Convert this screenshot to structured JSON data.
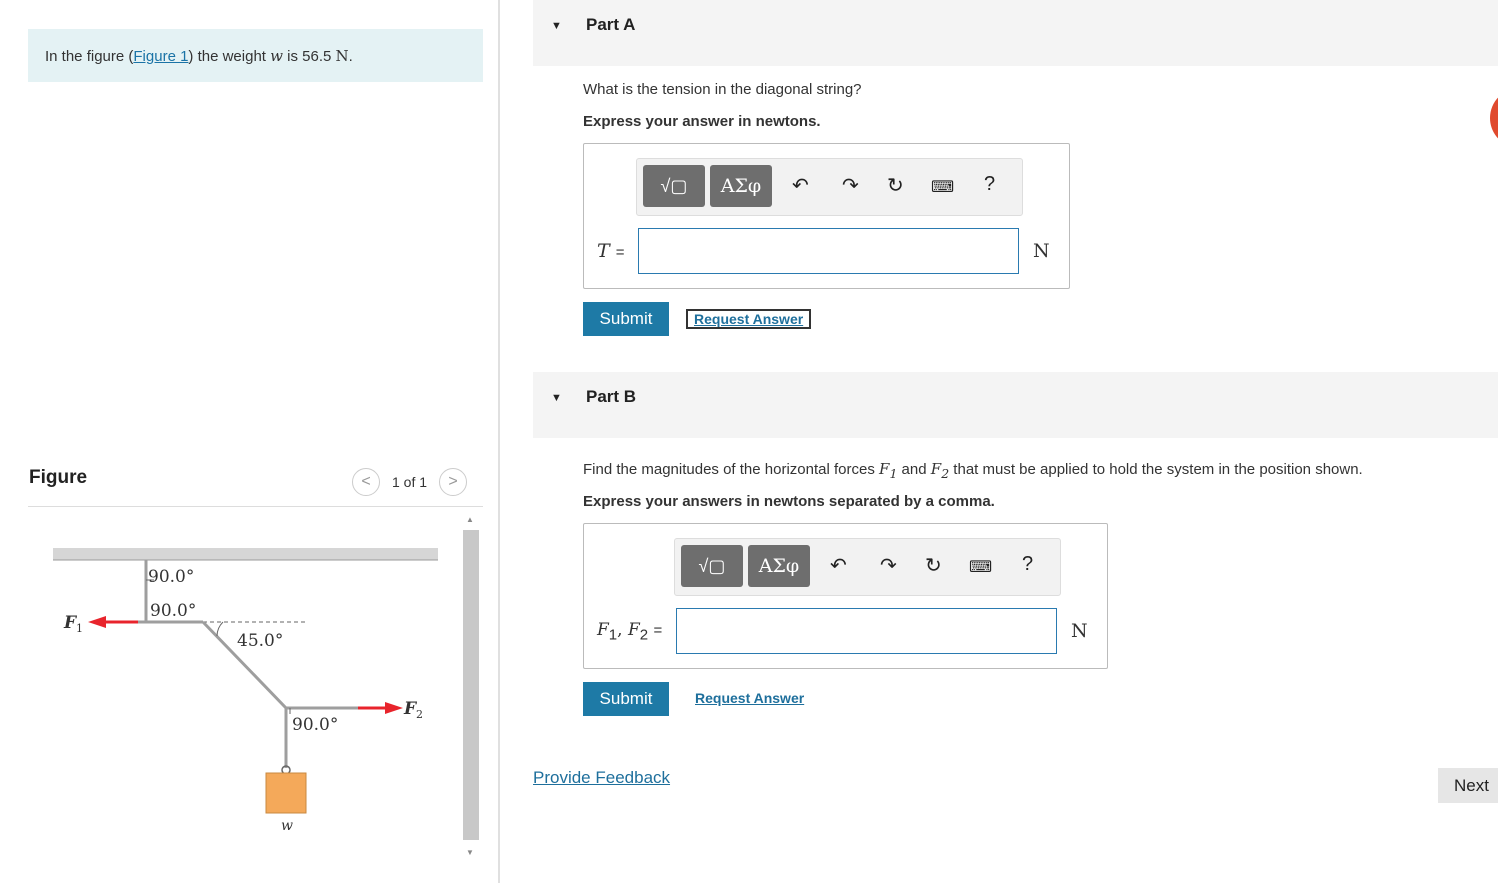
{
  "problem": {
    "prefix": "In the figure (",
    "link": "Figure 1",
    "middle": ") the weight ",
    "var": "w",
    "is_text": " is 56.5 ",
    "unit": "N",
    "suffix": "."
  },
  "figure": {
    "title": "Figure",
    "pager_text": "1 of 1",
    "prev": "<",
    "next": ">",
    "labels": {
      "angle_top": "90.0°",
      "angle_mid": "90.0°",
      "angle_diag": "45.0°",
      "angle_bottom": "90.0°",
      "f1": "F",
      "f1_sub": "1",
      "f2": "F",
      "f2_sub": "2",
      "w": "w"
    },
    "colors": {
      "arrow": "#e8242c",
      "weight": "#f4a95a",
      "ceiling": "#bdbdbd",
      "string": "#9e9e9e"
    }
  },
  "partA": {
    "title": "Part A",
    "question": "What is the tension in the diagonal string?",
    "instruction": "Express your answer in newtons.",
    "toolbar": {
      "btn1": "√▢",
      "btn2": "ΑΣφ",
      "help": "?"
    },
    "eq_var": "T",
    "eq_sign": "=",
    "input_value": "",
    "unit": "N",
    "submit": "Submit",
    "request": "Request Answer"
  },
  "partB": {
    "title": "Part B",
    "q_prefix": "Find the magnitudes of the horizontal forces ",
    "q_f1": "F",
    "q_f1_sub": "1",
    "q_and": " and ",
    "q_f2": "F",
    "q_f2_sub": "2",
    "q_suffix": " that must be applied to hold the system in the position shown.",
    "instruction": "Express your answers in newtons separated by a comma.",
    "toolbar": {
      "btn1": "√▢",
      "btn2": "ΑΣφ",
      "help": "?"
    },
    "eq_label_f1": "F",
    "eq_sub1": "1",
    "eq_comma": ", ",
    "eq_label_f2": "F",
    "eq_sub2": "2",
    "eq_sign": "=",
    "input_value": "",
    "unit": "N",
    "submit": "Submit",
    "request": "Request Answer"
  },
  "footer": {
    "feedback": "Provide Feedback",
    "next": "Next"
  }
}
